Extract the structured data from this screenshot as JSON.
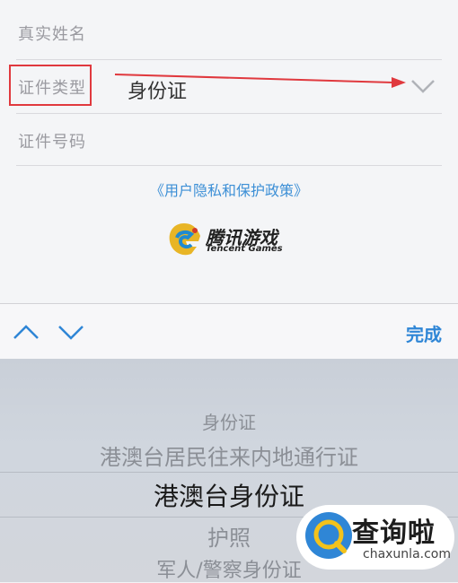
{
  "form": {
    "name_label": "真实姓名",
    "id_type_label": "证件类型",
    "id_type_value": "身份证",
    "id_number_label": "证件号码",
    "policy_link": "《用户隐私和保护政策》"
  },
  "logo": {
    "title": "腾讯游戏",
    "subtitle": "Tencent Games"
  },
  "toolbar": {
    "done_label": "完成"
  },
  "picker": {
    "options": [
      "身份证",
      "港澳台居民往来内地通行证",
      "港澳台身份证",
      "护照",
      "军人/警察身份证"
    ],
    "selected_index": 2
  },
  "watermark": {
    "title": "查询啦",
    "url": "chaxunla.com"
  },
  "colors": {
    "accent": "#2f86d6",
    "highlight": "#e0393e"
  }
}
